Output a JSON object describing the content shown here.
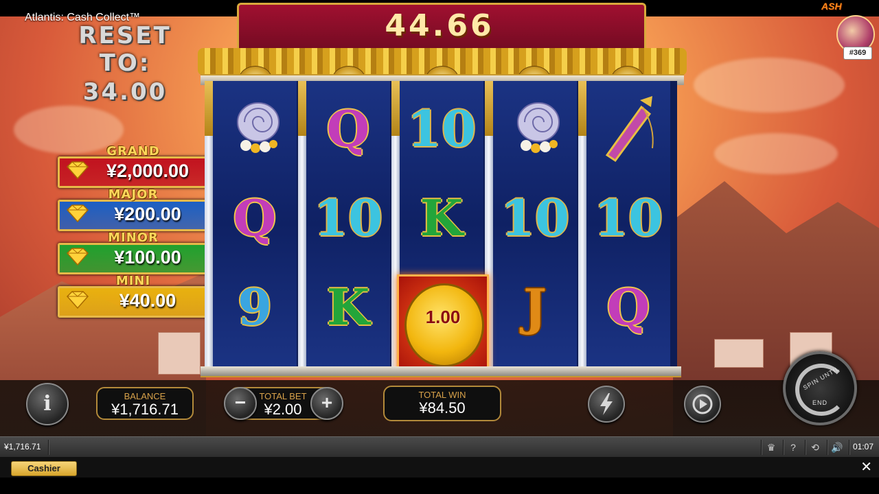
{
  "game": {
    "title": "Atlantis: Cash Collect™",
    "reset_line1": "RESET TO:",
    "reset_line2": "34.00",
    "counter": "44.66",
    "logo_text": "ASH",
    "player_badge": "#369"
  },
  "jackpots": [
    {
      "label": "GRAND",
      "value": "¥2,000.00",
      "color": "#c1121f"
    },
    {
      "label": "MAJOR",
      "value": "¥200.00",
      "color": "#1b5fc4"
    },
    {
      "label": "MINOR",
      "value": "¥100.00",
      "color": "#1fa12e"
    },
    {
      "label": "MINI",
      "value": "¥40.00",
      "color": "#e8b10f"
    }
  ],
  "reels": [
    [
      "shell",
      "Q",
      "9"
    ],
    [
      "Q",
      "10",
      "K"
    ],
    [
      "10",
      "K",
      "coin"
    ],
    [
      "shell",
      "10",
      "J"
    ],
    [
      "spear",
      "10",
      "Q"
    ]
  ],
  "coin_value": "1.00",
  "controls": {
    "info_glyph": "i",
    "balance_label": "BALANCE",
    "balance_value": "¥1,716.71",
    "total_bet_label": "TOTAL BET",
    "total_bet_value": "¥2.00",
    "minus_glyph": "−",
    "plus_glyph": "+",
    "total_win_label": "TOTAL WIN",
    "total_win_value": "¥84.50",
    "spin_label_top": "SPIN UNTIL",
    "spin_label_bottom": "END"
  },
  "sysbar": {
    "balance": "¥1,716.71",
    "time": "01:07"
  },
  "bottombar": {
    "cashier_label": "Cashier",
    "close_glyph": "✕"
  }
}
